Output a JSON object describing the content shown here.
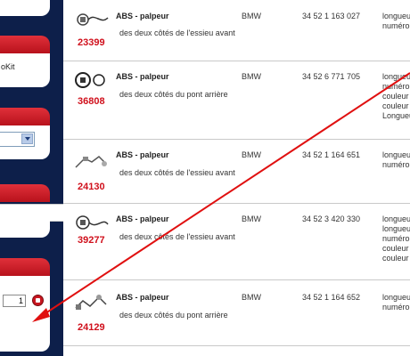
{
  "sidebar": {
    "kit_label": "oKit",
    "qty_value": "1"
  },
  "products": [
    {
      "code": "23399",
      "title": "ABS - palpeur",
      "desc": "des deux côtés de l'essieu avant",
      "brand": "BMW",
      "ref": "34 52 1 163 027",
      "notes": [
        "longueur",
        "numéro"
      ]
    },
    {
      "code": "36808",
      "title": "ABS - palpeur",
      "desc": "des deux côtés du pont arrière",
      "brand": "BMW",
      "ref": "34 52 6 771 705",
      "notes": [
        "longueur",
        "numéro",
        "couleur",
        "couleur",
        "Longueur"
      ]
    },
    {
      "code": "24130",
      "title": "ABS - palpeur",
      "desc": "des deux côtés de l'essieu avant",
      "brand": "BMW",
      "ref": "34 52 1 164 651",
      "notes": [
        "longueur",
        "numéro"
      ]
    },
    {
      "code": "39277",
      "title": "ABS - palpeur",
      "desc": "des deux côtés de l'essieu avant",
      "brand": "BMW",
      "ref": "34 52 3 420 330",
      "notes": [
        "longueur",
        "longueur",
        "numéro",
        "couleur",
        "couleur"
      ]
    },
    {
      "code": "24129",
      "title": "ABS - palpeur",
      "desc": "des deux côtés du pont arrière",
      "brand": "BMW",
      "ref": "34 52 1 164 652",
      "notes": [
        "longueur",
        "numéro"
      ]
    }
  ],
  "colors": {
    "accent_red": "#d0101c",
    "arrow_red": "#e01010",
    "sidebar_navy": "#0d1f4a"
  },
  "icons": [
    "dropdown-arrow-icon",
    "trash-icon",
    "sensor-cable-thumbnail"
  ]
}
